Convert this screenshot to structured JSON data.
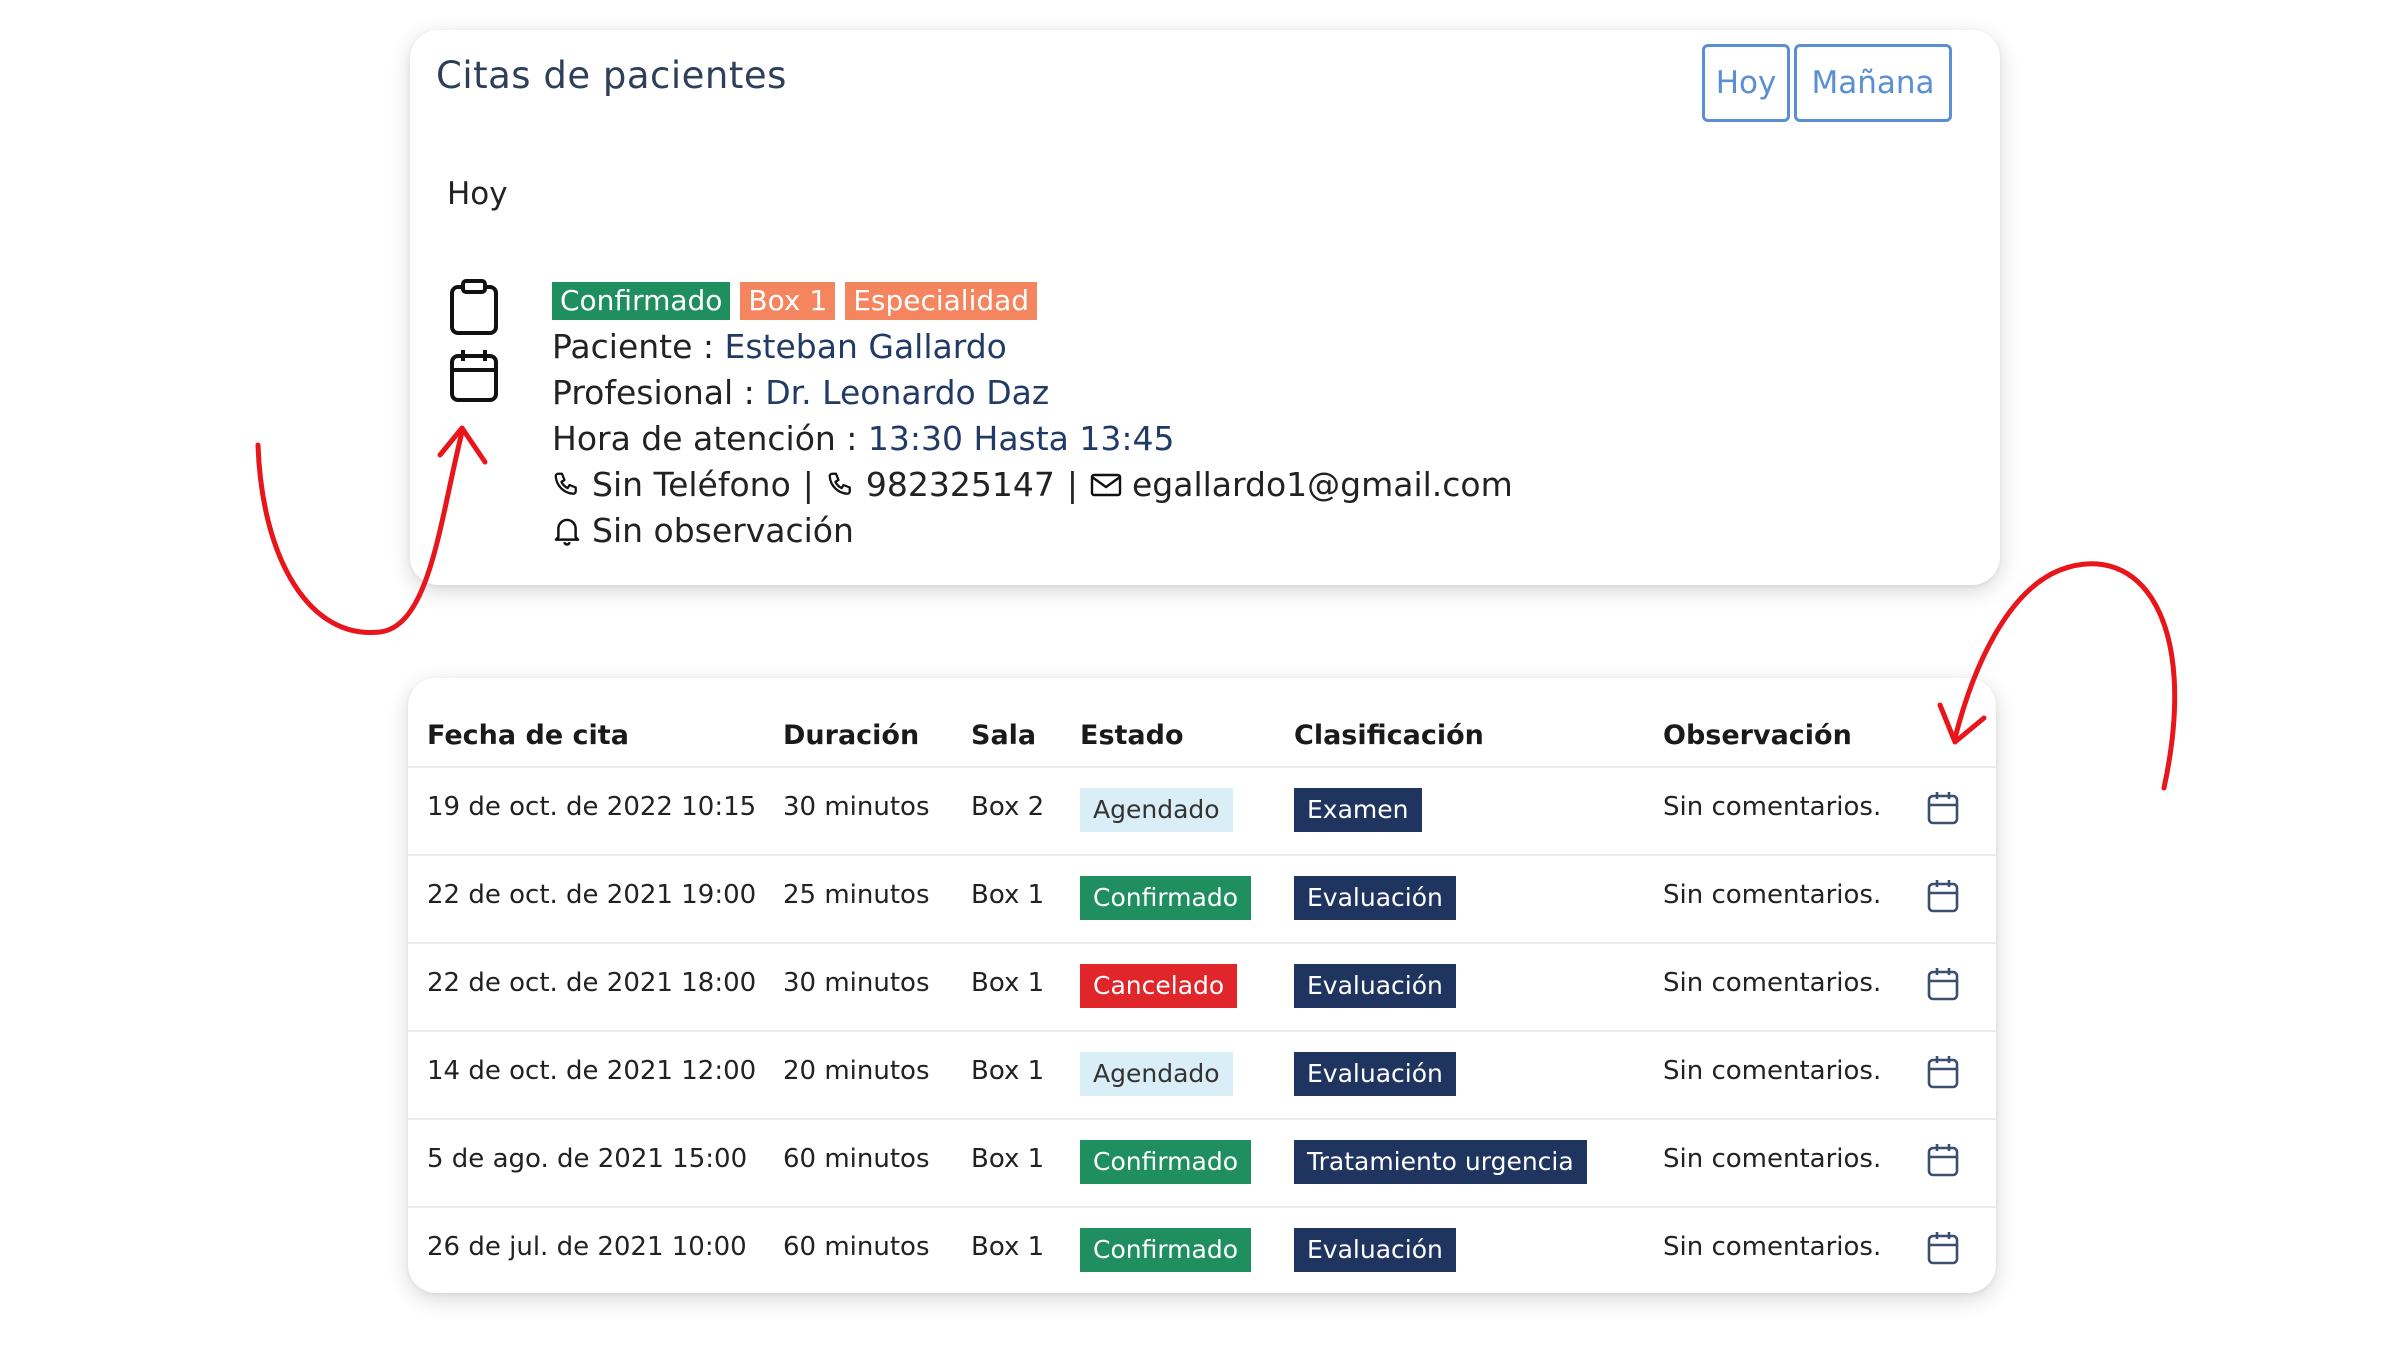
{
  "header": {
    "title": "Citas de pacientes",
    "btn_hoy": "Hoy",
    "btn_manana": "Mañana"
  },
  "section_label": "Hoy",
  "appointment": {
    "tags": [
      "Confirmado",
      "Box 1",
      "Especialidad"
    ],
    "paciente_label": "Paciente : ",
    "paciente_value": "Esteban Gallardo",
    "profesional_label": "Profesional : ",
    "profesional_value": "Dr. Leonardo Daz",
    "hora_label": "Hora de atención : ",
    "hora_value": "13:30 Hasta 13:45",
    "phone1": "Sin Teléfono",
    "phone2": "982325147",
    "email": "egallardo1@gmail.com",
    "separator": "|",
    "observacion": "Sin observación"
  },
  "table": {
    "headers": [
      "Fecha de cita",
      "Duración",
      "Sala",
      "Estado",
      "Clasificación",
      "Observación"
    ],
    "rows": [
      {
        "fecha": "19 de oct. de 2022 10:15",
        "duracion": "30 minutos",
        "sala": "Box 2",
        "estado": "Agendado",
        "clasificacion": "Examen",
        "observacion": "Sin comentarios."
      },
      {
        "fecha": "22 de oct. de 2021 19:00",
        "duracion": "25 minutos",
        "sala": "Box 1",
        "estado": "Confirmado",
        "clasificacion": "Evaluación",
        "observacion": "Sin comentarios."
      },
      {
        "fecha": "22 de oct. de 2021 18:00",
        "duracion": "30 minutos",
        "sala": "Box 1",
        "estado": "Cancelado",
        "clasificacion": "Evaluación",
        "observacion": "Sin comentarios."
      },
      {
        "fecha": "14 de oct. de 2021 12:00",
        "duracion": "20 minutos",
        "sala": "Box 1",
        "estado": "Agendado",
        "clasificacion": "Evaluación",
        "observacion": "Sin comentarios."
      },
      {
        "fecha": "5 de ago. de 2021 15:00",
        "duracion": "60 minutos",
        "sala": "Box 1",
        "estado": "Confirmado",
        "clasificacion": "Tratamiento urgencia",
        "observacion": "Sin comentarios."
      },
      {
        "fecha": "26 de jul. de 2021 10:00",
        "duracion": "60 minutos",
        "sala": "Box 1",
        "estado": "Confirmado",
        "clasificacion": "Evaluación",
        "observacion": "Sin comentarios."
      }
    ]
  },
  "colors": {
    "confirmado": "#1f8f5f",
    "agendado": "#d9eef6",
    "cancelado": "#e0262a",
    "clasificacion": "#1f3560",
    "tag_orange": "#f5855f",
    "button_blue": "#5b8fd3",
    "annotation_red": "#e8161b"
  },
  "icons": [
    "clipboard-icon",
    "calendar-icon",
    "phone-icon",
    "mail-icon",
    "bell-icon",
    "row-calendar-icon"
  ]
}
